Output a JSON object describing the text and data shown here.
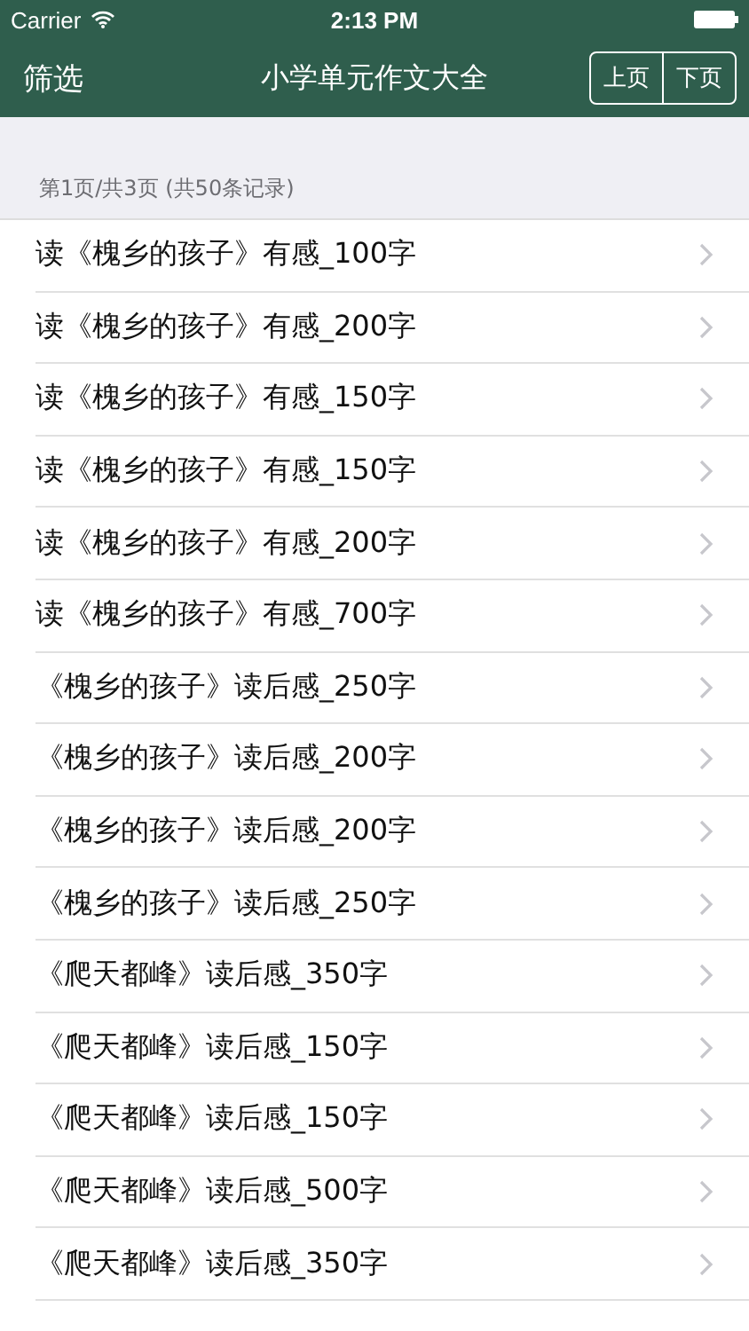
{
  "status_bar": {
    "carrier": "Carrier",
    "time": "2:13 PM"
  },
  "nav_bar": {
    "left": "筛选",
    "title": "小学单元作文大全",
    "buttons": [
      "上页",
      "下页"
    ]
  },
  "list": {
    "header": "第1页/共3页 (共50条记录)",
    "items": [
      "读《槐乡的孩子》有感_100字",
      "读《槐乡的孩子》有感_200字",
      "读《槐乡的孩子》有感_150字",
      "读《槐乡的孩子》有感_150字",
      "读《槐乡的孩子》有感_200字",
      "读《槐乡的孩子》有感_700字",
      "《槐乡的孩子》读后感_250字",
      "《槐乡的孩子》读后感_200字",
      "《槐乡的孩子》读后感_200字",
      "《槐乡的孩子》读后感_250字",
      "《爬天都峰》读后感_350字",
      "《爬天都峰》读后感_150字",
      "《爬天都峰》读后感_150字",
      "《爬天都峰》读后感_500字",
      "《爬天都峰》读后感_350字"
    ]
  }
}
